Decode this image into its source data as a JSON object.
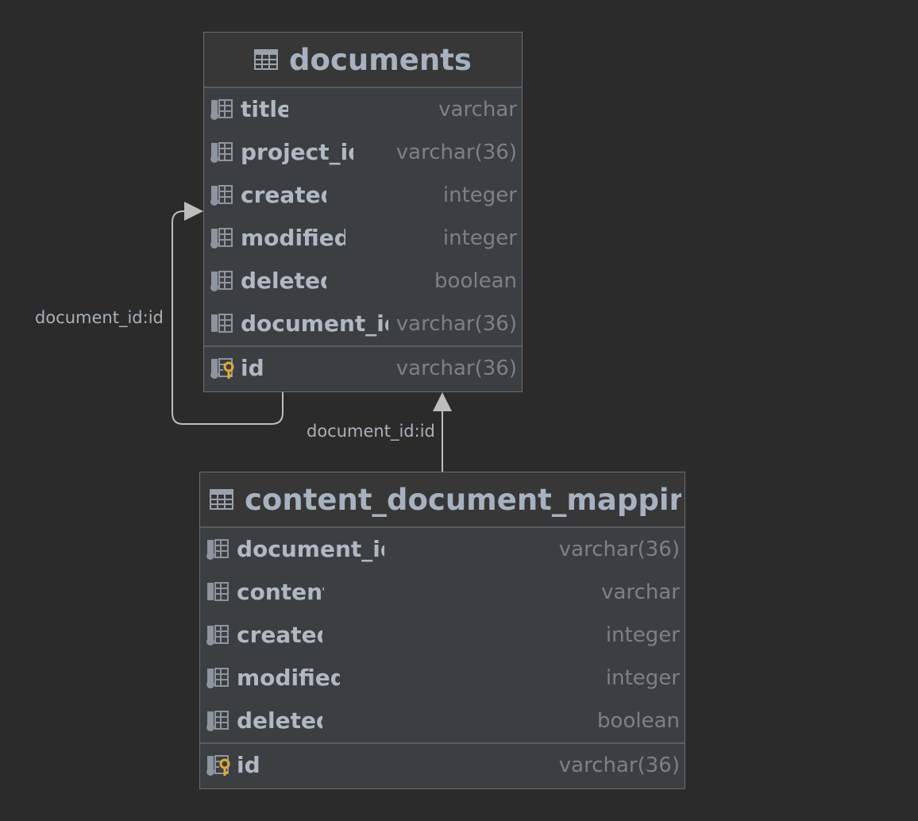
{
  "relations": [
    {
      "label": "document_id:id",
      "from": "documents.document_id",
      "to": "documents.id"
    },
    {
      "label": "document_id:id",
      "from": "content_document_mappings.document_id",
      "to": "documents.id"
    }
  ],
  "tables": {
    "documents": {
      "name": "documents",
      "columns": [
        {
          "name": "title",
          "type": "varchar"
        },
        {
          "name": "project_id",
          "type": "varchar(36)"
        },
        {
          "name": "created",
          "type": "integer"
        },
        {
          "name": "modified",
          "type": "integer"
        },
        {
          "name": "deleted",
          "type": "boolean"
        },
        {
          "name": "document_id",
          "type": "varchar(36)"
        }
      ],
      "primary_key": {
        "name": "id",
        "type": "varchar(36)"
      }
    },
    "mappings": {
      "name": "content_document_mappings",
      "columns": [
        {
          "name": "document_id",
          "type": "varchar(36)"
        },
        {
          "name": "content",
          "type": "varchar"
        },
        {
          "name": "created",
          "type": "integer"
        },
        {
          "name": "modified",
          "type": "integer"
        },
        {
          "name": "deleted",
          "type": "boolean"
        }
      ],
      "primary_key": {
        "name": "id",
        "type": "varchar(36)"
      }
    }
  },
  "colors": {
    "background": "#2b2b2b",
    "table_bg": "#3c3f41",
    "connector": "#bdbdbd",
    "key_icon": "#e0a93b"
  },
  "icons": {
    "table": "table-icon",
    "column": "column-icon",
    "primary_key": "primary-key-icon"
  }
}
